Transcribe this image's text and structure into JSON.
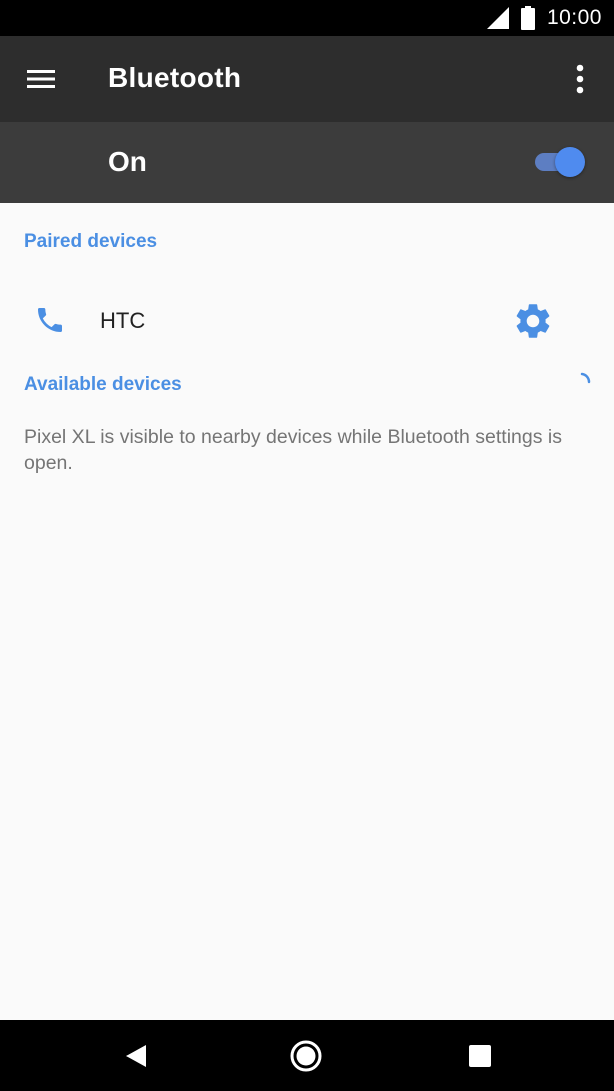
{
  "status_bar": {
    "time": "10:00",
    "icons": [
      "cellular-signal-icon",
      "battery-icon"
    ]
  },
  "app_bar": {
    "title": "Bluetooth",
    "icons": [
      "menu-icon",
      "more-vert-icon"
    ]
  },
  "master_switch": {
    "label": "On",
    "checked": true,
    "accent_color": "#4f8bef"
  },
  "paired_devices": {
    "header": "Paired devices",
    "items": [
      {
        "name": "HTC",
        "icon": "phone-icon",
        "action_icon": "gear-icon"
      }
    ]
  },
  "available_devices": {
    "header": "Available devices",
    "scanning": true,
    "info": "Pixel XL is visible to nearby devices while Bluetooth settings is open."
  },
  "nav_bar": {
    "icons": [
      "back-icon",
      "home-icon",
      "recents-icon"
    ]
  },
  "colors": {
    "section_header": "#4b8fe3",
    "app_bar": "#2d2d2d",
    "toggle_bar": "#3c3c3c"
  }
}
